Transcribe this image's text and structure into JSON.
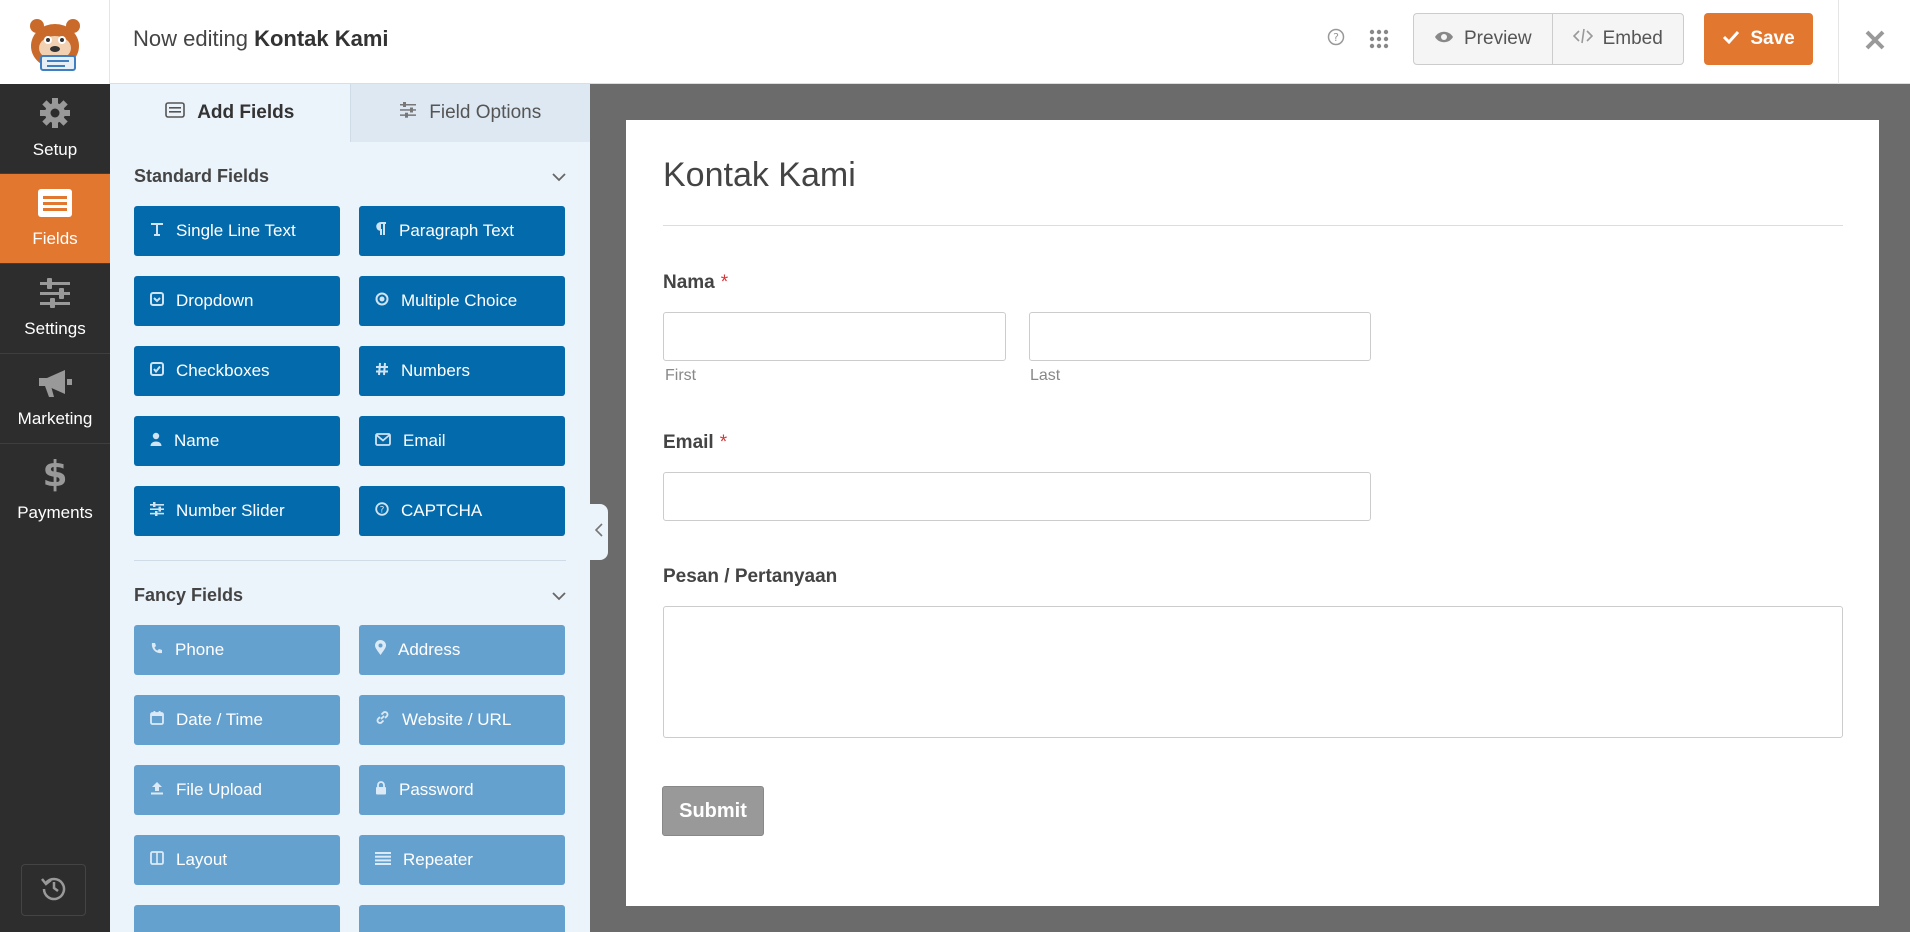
{
  "header": {
    "editing_prefix": "Now editing",
    "form_name": "Kontak Kami",
    "preview_label": "Preview",
    "embed_label": "Embed",
    "save_label": "Save"
  },
  "nav": {
    "items": [
      {
        "label": "Setup",
        "icon": "gear-icon"
      },
      {
        "label": "Fields",
        "icon": "fields-icon"
      },
      {
        "label": "Settings",
        "icon": "sliders-icon"
      },
      {
        "label": "Marketing",
        "icon": "megaphone-icon"
      },
      {
        "label": "Payments",
        "icon": "dollar-icon"
      }
    ]
  },
  "panel": {
    "tabs": [
      {
        "label": "Add Fields"
      },
      {
        "label": "Field Options"
      }
    ],
    "standard": {
      "title": "Standard Fields",
      "fields": [
        "Single Line Text",
        "Paragraph Text",
        "Dropdown",
        "Multiple Choice",
        "Checkboxes",
        "Numbers",
        "Name",
        "Email",
        "Number Slider",
        "CAPTCHA"
      ]
    },
    "fancy": {
      "title": "Fancy Fields",
      "fields": [
        "Phone",
        "Address",
        "Date / Time",
        "Website / URL",
        "File Upload",
        "Password",
        "Layout",
        "Repeater"
      ]
    }
  },
  "form": {
    "title": "Kontak Kami",
    "name_label": "Nama",
    "first_sublabel": "First",
    "last_sublabel": "Last",
    "email_label": "Email",
    "message_label": "Pesan / Pertanyaan",
    "required_mark": "*",
    "submit_label": "Submit"
  },
  "colors": {
    "accent": "#e27730",
    "standard_button": "#036aab",
    "fancy_button": "#65a1cf",
    "nav_bg": "#2d2d2d"
  }
}
